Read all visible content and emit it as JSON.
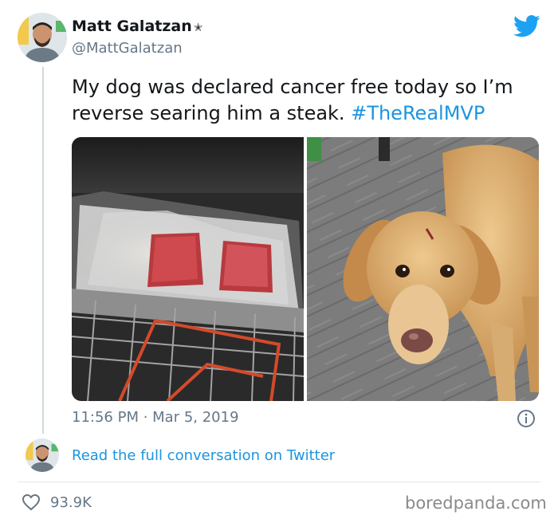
{
  "tweet": {
    "author_name": "Matt Galatzan",
    "verified_mark": "✭",
    "author_handle": "@MattGalatzan",
    "text": "My dog was declared cancer free today so I’m reverse searing him a steak.",
    "hashtag": "#TheRealMVP",
    "timestamp": "11:56 PM · Mar 5, 2019",
    "read_full_conversation": "Read the full conversation on Twitter",
    "likes": "93.9K"
  },
  "media": {
    "left_image": "steaks-on-oven-rack-photo",
    "right_image": "golden-retriever-photo"
  },
  "watermark": "boredpanda.com",
  "colors": {
    "link_blue": "#1b95e0",
    "twitter_blue": "#1da1f2",
    "text_primary": "#14171a",
    "text_secondary": "#657786"
  },
  "icons": {
    "brand": "twitter-bird-icon",
    "info": "info-icon",
    "like": "heart-icon"
  }
}
